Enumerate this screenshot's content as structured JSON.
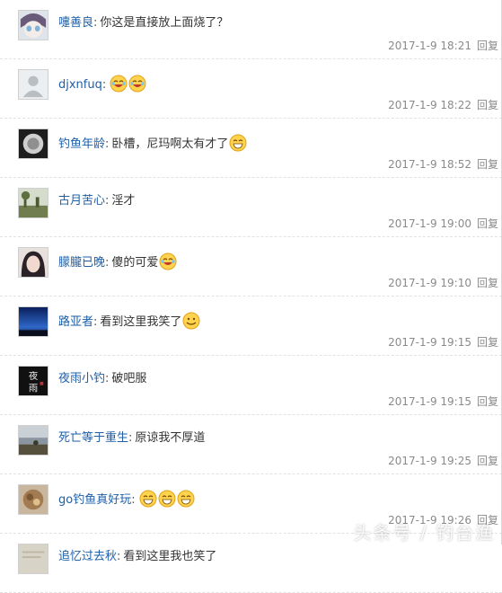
{
  "comments": [
    {
      "user": "嚏善良",
      "text": "你这是直接放上面烧了？",
      "emojis": [],
      "time": "2017-1-9 18:21",
      "avatar": "anime-face"
    },
    {
      "user": "djxnfuq",
      "text": "",
      "emojis": [
        "laugh-emoji",
        "laugh-emoji"
      ],
      "time": "2017-1-9 18:22",
      "avatar": "default-gray"
    },
    {
      "user": "钓鱼年龄",
      "text": "卧槽，尼玛啊太有才了",
      "emojis": [
        "grin-emoji"
      ],
      "time": "2017-1-9 18:52",
      "avatar": "dark-circle"
    },
    {
      "user": "古月苦心",
      "text": "淫才",
      "emojis": [],
      "time": "2017-1-9 19:00",
      "avatar": "nature-scene"
    },
    {
      "user": "朦朧已晚",
      "text": "傻的可爱",
      "emojis": [
        "laugh-emoji"
      ],
      "time": "2017-1-9 19:10",
      "avatar": "girl-portrait"
    },
    {
      "user": "路亚者",
      "text": "看到这里我笑了",
      "emojis": [
        "smile-emoji"
      ],
      "time": "2017-1-9 19:15",
      "avatar": "night-sky"
    },
    {
      "user": "夜雨小钓",
      "text": "破吧服",
      "emojis": [],
      "time": "2017-1-9 19:15",
      "avatar": "calligraphy"
    },
    {
      "user": "死亡等于重生",
      "text": "原谅我不厚道",
      "emojis": [],
      "time": "2017-1-9 19:25",
      "avatar": "cloudy-landscape"
    },
    {
      "user": "go钓鱼真好玩",
      "text": "",
      "emojis": [
        "grin-emoji",
        "grin-emoji",
        "grin-emoji"
      ],
      "time": "2017-1-9 19:26",
      "avatar": "food-photo"
    },
    {
      "user": "追忆过去秋",
      "text": "看到这里我也笑了",
      "emojis": [],
      "time": "",
      "avatar": "paper-texture"
    }
  ],
  "reply_label": "回复",
  "colon": ":",
  "watermark": "头条号 / 钓台渔"
}
